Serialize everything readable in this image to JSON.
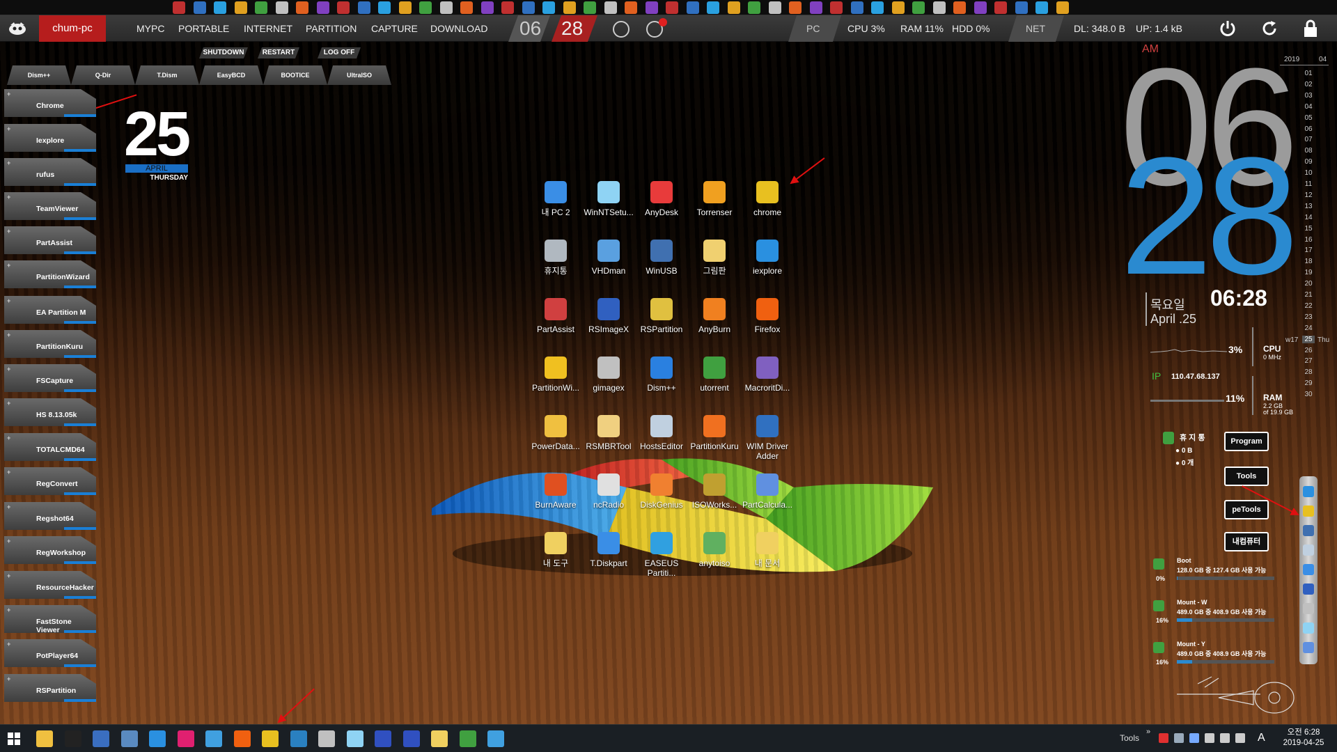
{
  "toolbar": {
    "icon_count": 44
  },
  "topbar": {
    "hostname": "chum-pc",
    "menu": [
      "MYPC",
      "PORTABLE",
      "INTERNET",
      "PARTITION",
      "CAPTURE",
      "DOWNLOAD"
    ],
    "hour": "06",
    "minute": "28",
    "pc_label": "PC",
    "cpu": "CPU  3%",
    "ram": "RAM  11%",
    "hdd": "HDD  0%",
    "net_label": "NET",
    "dl": "DL: 348.0 B",
    "up": "UP: 1.4 kB"
  },
  "power_buttons": [
    "SHUTDOWN",
    "RESTART",
    "LOG OFF"
  ],
  "quick_buttons": [
    "Dism++",
    "Q-Dir",
    "T.Dism",
    "EasyBCD",
    "BOOTICE",
    "UltraISO"
  ],
  "launcher": [
    "Chrome",
    "Iexplore",
    "rufus",
    "TeamViewer",
    "PartAssist",
    "PartitionWizard",
    "EA Partition M",
    "PartitionKuru",
    "FSCapture",
    "HS 8.13.05k",
    "TOTALCMD64",
    "RegConvert",
    "Regshot64",
    "RegWorkshop",
    "ResourceHacker",
    "FastStone Viewer",
    "PotPlayer64",
    "RSPartition"
  ],
  "date_widget": {
    "day": "25",
    "month": "APRIL",
    "weekday": "THURSDAY"
  },
  "icons": [
    {
      "label": "내 PC 2",
      "color": "#3a8ee6"
    },
    {
      "label": "WinNTSetu...",
      "color": "#8fd3f4"
    },
    {
      "label": "AnyDesk",
      "color": "#e83b3b"
    },
    {
      "label": "Torrenser",
      "color": "#f0a020"
    },
    {
      "label": "chrome",
      "color": "#e8c020"
    },
    {
      "label": "휴지통",
      "color": "#b0b8c0"
    },
    {
      "label": "VHDman",
      "color": "#5aa0e0"
    },
    {
      "label": "WinUSB",
      "color": "#4070b0"
    },
    {
      "label": "그림판",
      "color": "#f0d070"
    },
    {
      "label": "iexplore",
      "color": "#2a90e0"
    },
    {
      "label": "PartAssist",
      "color": "#d04040"
    },
    {
      "label": "RSImageX",
      "color": "#3060c0"
    },
    {
      "label": "RSPartition",
      "color": "#e0c040"
    },
    {
      "label": "AnyBurn",
      "color": "#f08020"
    },
    {
      "label": "Firefox",
      "color": "#f06010"
    },
    {
      "label": "PartitionWi...",
      "color": "#f0c020"
    },
    {
      "label": "gimagex",
      "color": "#c0c0c0"
    },
    {
      "label": "Dism++",
      "color": "#2a80e0"
    },
    {
      "label": "utorrent",
      "color": "#40a040"
    },
    {
      "label": "MacroritDi...",
      "color": "#8060c0"
    },
    {
      "label": "PowerData...",
      "color": "#f0c040"
    },
    {
      "label": "RSMBRTool",
      "color": "#f0d080"
    },
    {
      "label": "HostsEditor",
      "color": "#c0d0e0"
    },
    {
      "label": "PartitionKuru",
      "color": "#f07020"
    },
    {
      "label": "WIM Driver Adder",
      "color": "#3070c0"
    },
    {
      "label": "BurnAware",
      "color": "#e05020"
    },
    {
      "label": "ncRadio",
      "color": "#e0e0e0"
    },
    {
      "label": "DiskGenius",
      "color": "#f08030"
    },
    {
      "label": "ISOWorks...",
      "color": "#c0a030"
    },
    {
      "label": "PartCalcula...",
      "color": "#6090e0"
    },
    {
      "label": "내 도구",
      "color": "#f0d060"
    },
    {
      "label": "T.Diskpart",
      "color": "#3a8ee6"
    },
    {
      "label": "EASEUS Partiti...",
      "color": "#30a0e0"
    },
    {
      "label": "anytoiso",
      "color": "#60b060"
    },
    {
      "label": "내 문서",
      "color": "#f0d060"
    }
  ],
  "right_clock": {
    "ampm": "AM",
    "hour": "06",
    "minute": "28",
    "kday": "목요일",
    "kdate": "April .25",
    "time": "06:28"
  },
  "calendar": {
    "year": "2019",
    "month": "04",
    "days": [
      "01",
      "02",
      "03",
      "04",
      "05",
      "06",
      "07",
      "08",
      "09",
      "10",
      "11",
      "12",
      "13",
      "14",
      "15",
      "16",
      "17",
      "18",
      "19",
      "20",
      "21",
      "22",
      "23",
      "24",
      "25",
      "26",
      "27",
      "28",
      "29",
      "30"
    ],
    "week": "w17",
    "today": "25",
    "today_wd": "Thu"
  },
  "monitor": {
    "cpu_pct": "3%",
    "cpu_label": "CPU",
    "cpu_sub": "0 MHz",
    "ip_label": "IP",
    "ip": "110.47.68.137",
    "ram_pct": "11%",
    "ram_label": "RAM",
    "ram_sub1": "2.2 GB",
    "ram_sub2": "of 19.9 GB",
    "recycle_label": "휴 지 통",
    "recycle_size": "0 B",
    "recycle_count": "0 개"
  },
  "shortcut_buttons": [
    "Program",
    "Tools",
    "peTools",
    "내컴퓨터"
  ],
  "drives": [
    {
      "name": "Boot",
      "info": "128.0 GB 중 127.4 GB 사용 가능",
      "pct_label": "0%",
      "pct": 0
    },
    {
      "name": "Mount - W",
      "info": "489.0 GB 중 408.9 GB 사용 가능",
      "pct_label": "16%",
      "pct": 16
    },
    {
      "name": "Mount - Y",
      "info": "489.0 GB 중 408.9 GB 사용 가능",
      "pct_label": "16%",
      "pct": 16
    }
  ],
  "taskbar": {
    "tools_label": "Tools",
    "time": "오전 6:28",
    "date": "2019-04-25",
    "ime": "A"
  }
}
